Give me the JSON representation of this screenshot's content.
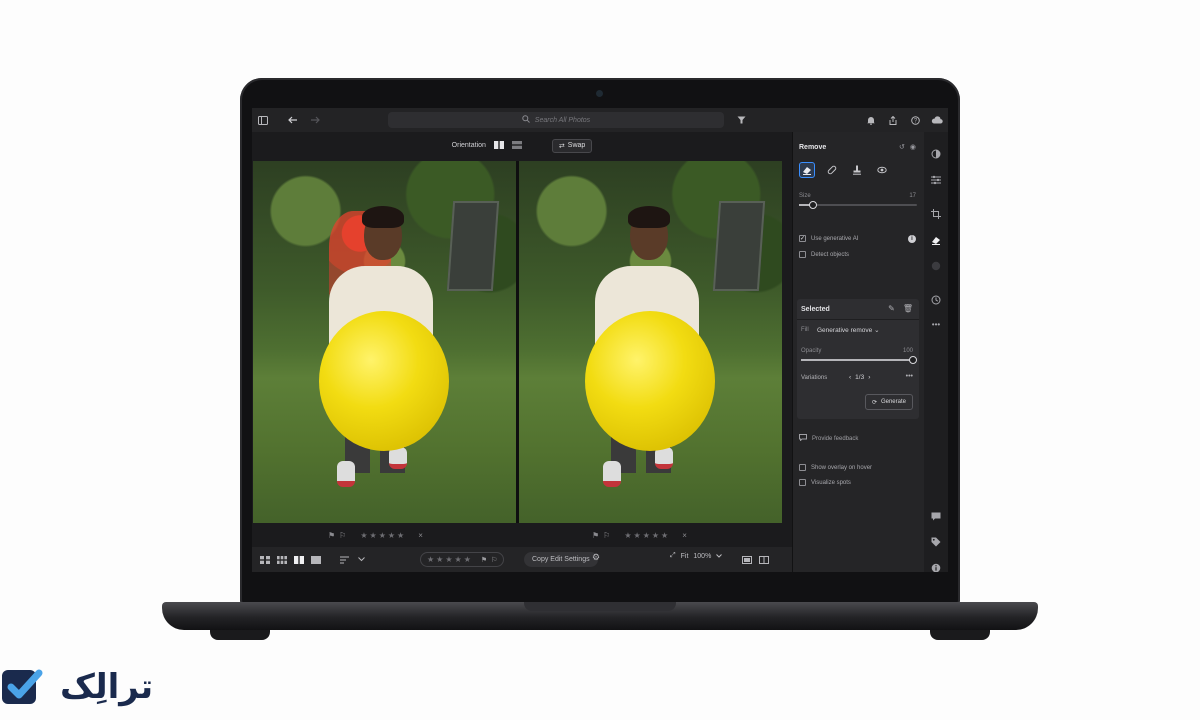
{
  "top_bar": {
    "search_placeholder": "Search All Photos",
    "icons": [
      "panel-icon",
      "back-icon",
      "forward-icon",
      "search-icon",
      "filter-icon",
      "bell-icon",
      "share-icon",
      "help-icon",
      "cloud-icon"
    ]
  },
  "compare": {
    "orientation_label": "Orientation",
    "swap_label": "Swap"
  },
  "rating": {
    "stars": "★★★★★",
    "close": "×"
  },
  "bottom_bar": {
    "stars": "★★★★★",
    "copy_label": "Copy Edit Settings",
    "fit_label": "Fit",
    "zoom_label": "100%"
  },
  "panel": {
    "title": "Remove",
    "size_label": "Size",
    "size_value": "17",
    "size_fraction": 0.12,
    "use_gen_ai_label": "Use generative AI",
    "use_gen_ai_checked": true,
    "detect_objects_label": "Detect objects",
    "detect_objects_checked": false,
    "selected": {
      "title": "Selected",
      "fill_label": "Fill",
      "fill_value": "Generative remove",
      "opacity_label": "Opacity",
      "opacity_value": "100",
      "opacity_fraction": 1.0,
      "variations_label": "Variations",
      "variations_value": "1/3",
      "generate_label": "Generate"
    },
    "feedback_label": "Provide feedback",
    "show_overlay_label": "Show overlay on hover",
    "visualize_spots_label": "Visualize spots"
  },
  "brand": {
    "logo_text": "ترالِک",
    "colors": {
      "accent": "#3a8fff",
      "logo_blue": "#1a2a4d",
      "logo_light": "#4aa3e8",
      "ball_yellow": "#f2dc12",
      "mask_red": "#e5412d"
    }
  }
}
